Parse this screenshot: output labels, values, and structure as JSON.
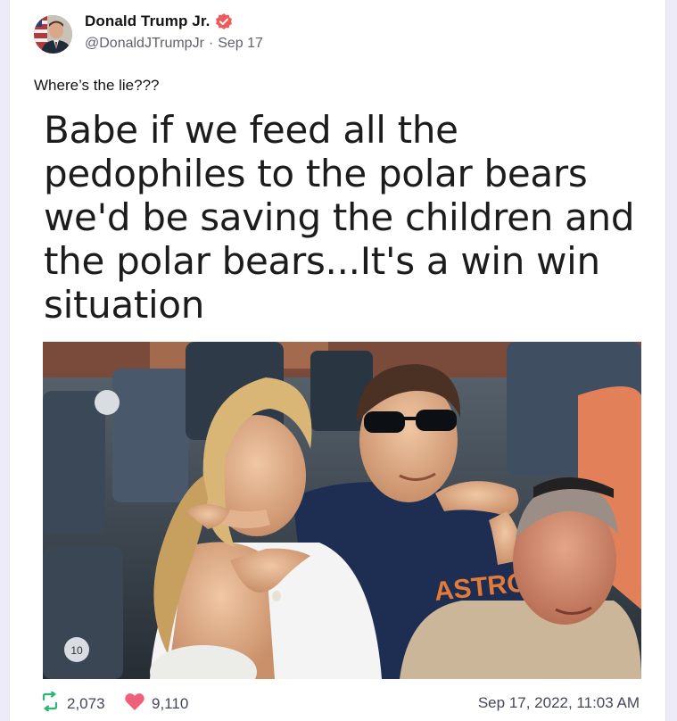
{
  "post": {
    "author": {
      "name": "Donald Trump Jr.",
      "handle": "@DonaldJTrumpJr",
      "date": "Sep 17",
      "verified_color": "#f05a5a"
    },
    "text": "Where’s the lie???",
    "meme_caption": "Babe if we feed all the pedophiles to the polar bears we'd be saving the children and the polar bears...It's a win win situation",
    "photo": {
      "jersey_text": "ASTROS",
      "seat_label": "10"
    },
    "stats": {
      "retweets": "2,073",
      "likes": "9,110",
      "retweet_icon": "retweet-icon",
      "like_icon": "heart-icon",
      "retweet_color": "#2bb673",
      "like_color": "#f0607a"
    },
    "timestamp": "Sep 17, 2022, 11:03 AM"
  }
}
